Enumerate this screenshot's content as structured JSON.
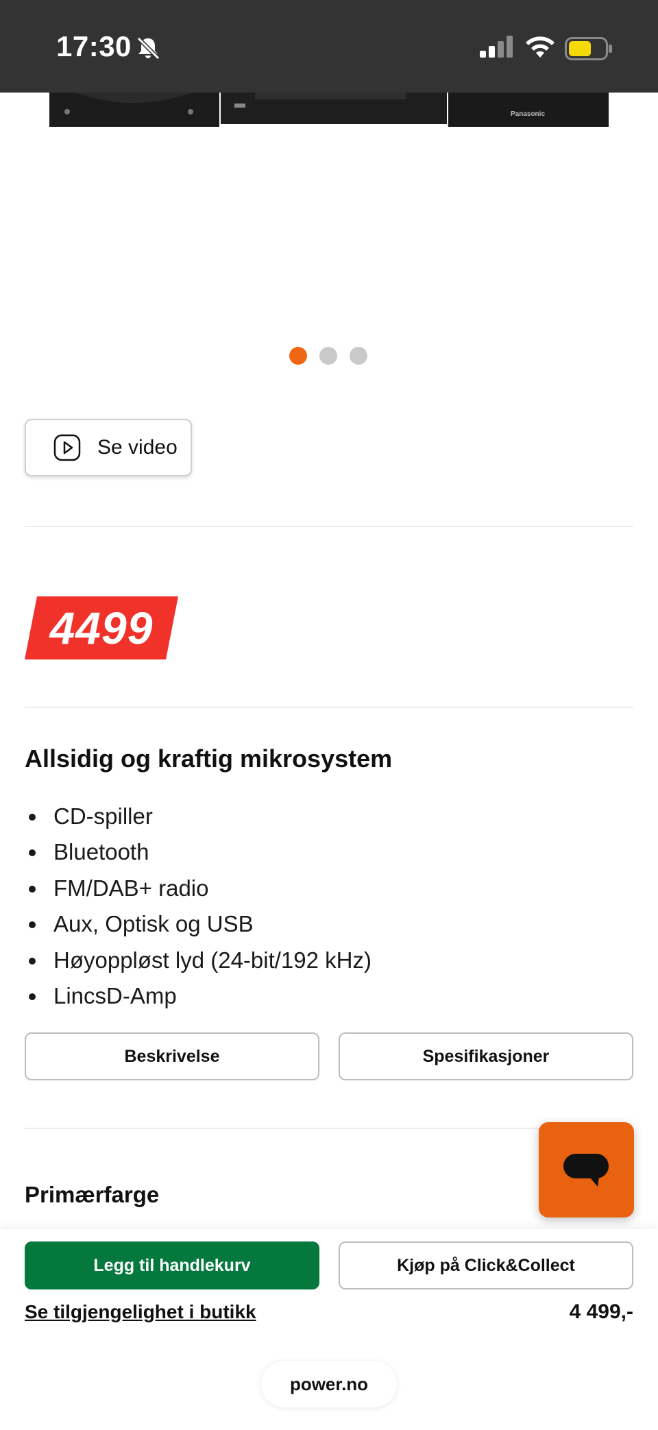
{
  "status_bar": {
    "time": "17:30",
    "battery_color": "#f5d90a"
  },
  "product_image": {
    "brand_text": "Panasonic"
  },
  "carousel": {
    "dots": 3,
    "active_index": 0,
    "active_color": "#f06614"
  },
  "video_button": {
    "label": "Se video",
    "icon": "play-circle-icon"
  },
  "price": {
    "value": "4499",
    "tag_color": "#f0322a"
  },
  "description": {
    "title": "Allsidig og kraftig mikrosystem",
    "features": [
      "CD-spiller",
      "Bluetooth",
      "FM/DAB+ radio",
      "Aux, Optisk og USB",
      "Høyoppløst lyd (24-bit/192 kHz)",
      "LincsD-Amp"
    ]
  },
  "tabs": {
    "description_label": "Beskrivelse",
    "specs_label": "Spesifikasjoner"
  },
  "color_section": {
    "title": "Primærfarge"
  },
  "chat": {
    "icon": "chat-bubble-icon",
    "color": "#e8620f"
  },
  "bottom_bar": {
    "add_to_cart_label": "Legg til handlekurv",
    "click_collect_label": "Kjøp på Click&Collect",
    "availability_link": "Se tilgjengelighet i butikk",
    "price": "4 499,-",
    "add_color": "#05783e"
  },
  "browser": {
    "url": "power.no"
  }
}
